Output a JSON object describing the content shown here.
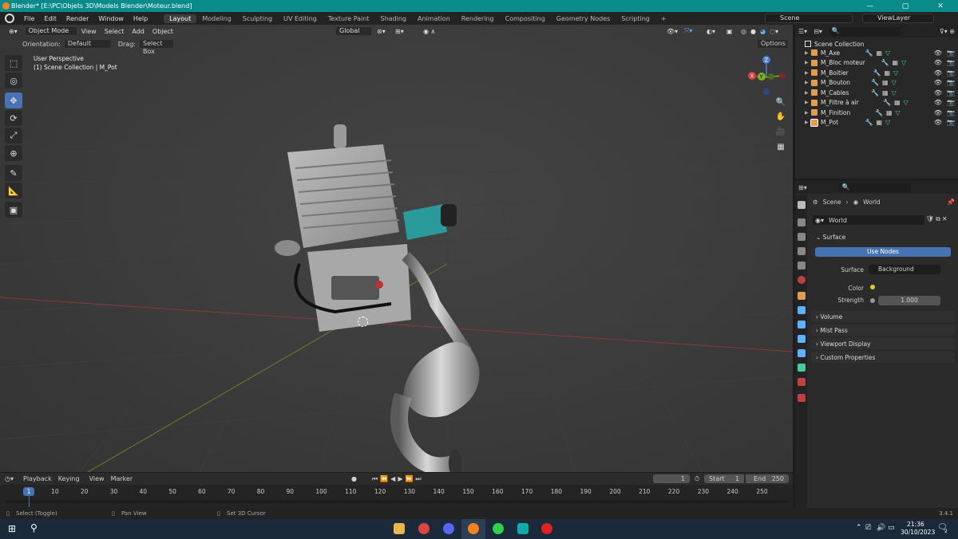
{
  "window": {
    "title": "Blender* [E:\\PC\\Objets 3D\\Models Blender\\Moteur.blend]",
    "min": "—",
    "max": "▢",
    "close": "✕"
  },
  "menu": {
    "items": [
      "File",
      "Edit",
      "Render",
      "Window",
      "Help"
    ],
    "workspaces": [
      "Layout",
      "Modeling",
      "Sculpting",
      "UV Editing",
      "Texture Paint",
      "Shading",
      "Animation",
      "Rendering",
      "Compositing",
      "Geometry Nodes",
      "Scripting"
    ],
    "add_tab": "+",
    "scene": "Scene",
    "view_layer": "ViewLayer"
  },
  "viewport": {
    "mode": "Object Mode",
    "menus": [
      "View",
      "Select",
      "Add",
      "Object"
    ],
    "transform": "Global",
    "orientation_label": "Orientation:",
    "orientation_value": "Default",
    "drag_label": "Drag:",
    "drag_value": "Select Box",
    "options": "Options",
    "perspective": "User Perspective",
    "collection_info": "(1) Scene Collection | M_Pot",
    "gizmo": {
      "z": "Z",
      "y": "Y",
      "x": "X"
    }
  },
  "outliner": {
    "root": "Scene Collection",
    "objects": [
      "M_Axe",
      "M_Bloc moteur",
      "M_Boitier",
      "M_Bouton",
      "M_Cables",
      "M_Filtre à air",
      "M_Finition",
      "M_Pot"
    ]
  },
  "properties": {
    "breadcrumb_scene": "Scene",
    "breadcrumb_world": "World",
    "world_name": "World",
    "surface_panel": "Surface",
    "use_nodes": "Use Nodes",
    "surface_label": "Surface",
    "surface_value": "Background",
    "color_label": "Color",
    "strength_label": "Strength",
    "strength_value": "1.000",
    "panels": [
      "Volume",
      "Mist Pass",
      "Viewport Display",
      "Custom Properties"
    ]
  },
  "timeline": {
    "menus": [
      "Playback",
      "Keying",
      "View",
      "Marker"
    ],
    "current_frame": "1",
    "start_label": "Start",
    "start_value": "1",
    "end_label": "End",
    "end_value": "250",
    "ticks": [
      "10",
      "20",
      "30",
      "40",
      "50",
      "60",
      "70",
      "80",
      "90",
      "100",
      "110",
      "120",
      "130",
      "140",
      "150",
      "160",
      "170",
      "180",
      "190",
      "200",
      "210",
      "220",
      "230",
      "240",
      "250"
    ]
  },
  "status": {
    "left": "Select (Toggle)",
    "mid": "Pan View",
    "right": "Set 3D Cursor",
    "version": "3.4.1"
  },
  "taskbar": {
    "time": "21:36",
    "date": "30/10/2023",
    "notif": "2"
  },
  "colors": {
    "accent": "#4772b3",
    "title": "#0a8b8b",
    "object": "#e19c4f",
    "modifier": "#5fb0ff",
    "mesh": "#40d0a0"
  }
}
